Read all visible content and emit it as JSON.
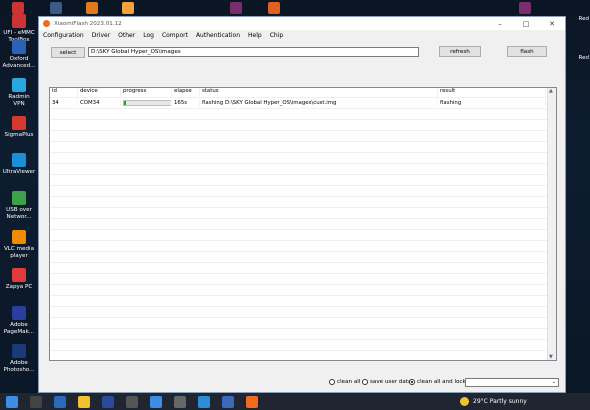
{
  "desktop": {
    "icons": [
      {
        "label": "UFI - eMMC ToolBox",
        "color": "#c33"
      },
      {
        "label": "Oxford Advanced...",
        "color": "#2a62b8"
      },
      {
        "label": "Radmin VPN",
        "color": "#26a7e0"
      },
      {
        "label": "SigmaPlus",
        "color": "#d63a2e"
      },
      {
        "label": "UltraViewer",
        "color": "#1b8fd6"
      },
      {
        "label": "USB over Networ...",
        "color": "#3da34a"
      },
      {
        "label": "VLC media player",
        "color": "#f08a00"
      },
      {
        "label": "Zapya PC",
        "color": "#e03a3a"
      },
      {
        "label": "Adobe PageMak...",
        "color": "#2a3ea0"
      },
      {
        "label": "Adobe Photosho...",
        "color": "#1b3a7a"
      }
    ],
    "right_texts": [
      "Red",
      "Red"
    ]
  },
  "window": {
    "title": "XiaomiFlash 2023.01.12",
    "menu": [
      "Configuration",
      "Driver",
      "Other",
      "Log",
      "Comport",
      "Authentication",
      "Help",
      "Chip"
    ],
    "select_label": "select",
    "path_value": "D:\\SKY Global Hyper_OS\\images",
    "refresh_label": "refresh",
    "flash_label": "flash",
    "columns": [
      "id",
      "device",
      "progress",
      "elapse",
      "status",
      "result"
    ],
    "rows": [
      {
        "id": "34",
        "device": "COM34",
        "progress": 0.05,
        "elapse": "165s",
        "status": "flashing D:\\SKY Global Hyper_OS\\images\\cust.img",
        "result": "flashing"
      }
    ],
    "options": [
      {
        "label": "clean all",
        "selected": false
      },
      {
        "label": "save user data",
        "selected": false
      },
      {
        "label": "clean all and lock",
        "selected": true
      }
    ]
  },
  "taskbar": {
    "weather_temp": "29°C",
    "weather_text": "Partly sunny"
  }
}
